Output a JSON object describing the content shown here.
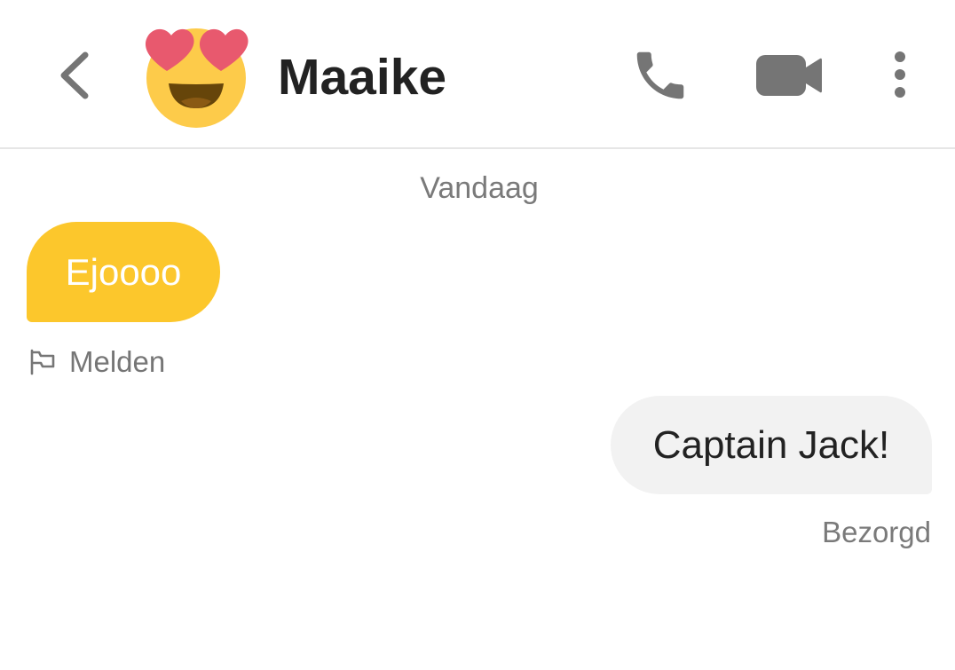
{
  "header": {
    "contact_name": "Maaike",
    "icons": {
      "back": "chevron-left-icon",
      "avatar": "heart-eyes-emoji",
      "call": "phone-icon",
      "video": "video-camera-icon",
      "more": "more-vertical-icon"
    }
  },
  "conversation": {
    "date_separator": "Vandaag",
    "messages": [
      {
        "direction": "incoming",
        "text": "Ejoooo",
        "report_label": "Melden",
        "report_icon": "flag-icon"
      },
      {
        "direction": "outgoing",
        "text": "Captain Jack!",
        "status": "Bezorgd"
      }
    ]
  },
  "colors": {
    "incoming_bubble": "#fcc72c",
    "outgoing_bubble": "#f2f2f2",
    "icon_gray": "#757575",
    "text_dark": "#222222",
    "text_muted": "#7a7a7a"
  }
}
